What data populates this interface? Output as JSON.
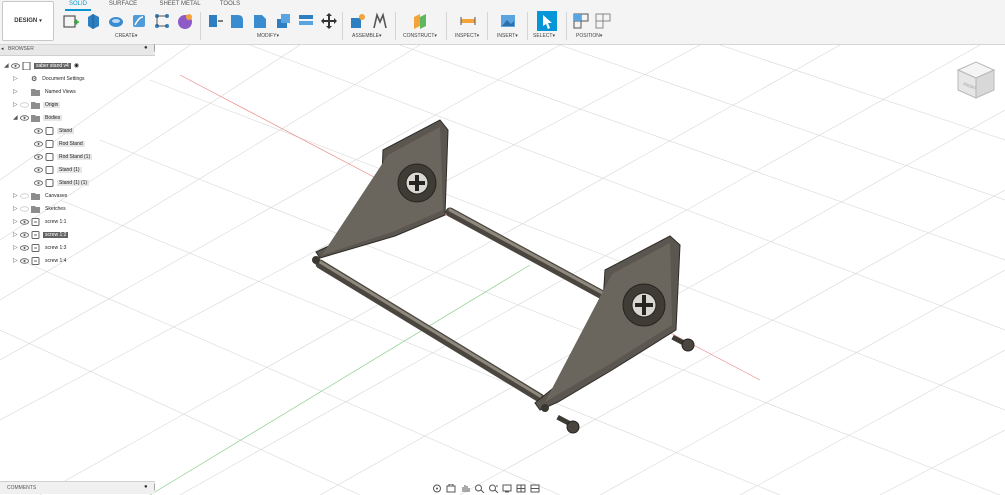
{
  "toolbar": {
    "workspace": "DESIGN",
    "tabs": [
      "SOLID",
      "SURFACE",
      "SHEET METAL",
      "TOOLS"
    ],
    "groups": [
      "CREATE",
      "MODIFY",
      "ASSEMBLE",
      "CONSTRUCT",
      "INSPECT",
      "INSERT",
      "SELECT",
      "POSITION"
    ],
    "accent": "#0696d7"
  },
  "browser": {
    "title": "BROWSER",
    "root": "saber stand v4",
    "items": [
      {
        "label": "Document Settings",
        "icon": "gear-icon"
      },
      {
        "label": "Named Views",
        "icon": "folder-icon"
      },
      {
        "label": "Origin",
        "icon": "folder-icon"
      },
      {
        "label": "Bodies",
        "icon": "folder-icon"
      },
      {
        "label": "Stand",
        "icon": "body-icon"
      },
      {
        "label": "Rod Stand",
        "icon": "body-icon"
      },
      {
        "label": "Rod Stand (1)",
        "icon": "body-icon"
      },
      {
        "label": "Stand (1)",
        "icon": "body-icon"
      },
      {
        "label": "Stand (1) (1)",
        "icon": "body-icon"
      },
      {
        "label": "Canvases",
        "icon": "folder-icon"
      },
      {
        "label": "Sketches",
        "icon": "folder-icon"
      },
      {
        "label": "screw 1:1",
        "icon": "component-icon"
      },
      {
        "label": "screw 1:2",
        "icon": "component-icon"
      },
      {
        "label": "screw 1:3",
        "icon": "component-icon"
      },
      {
        "label": "screw 1:4",
        "icon": "component-icon"
      }
    ]
  },
  "comments": {
    "title": "COMMENTS"
  },
  "viewcube": {
    "face": "FRONT"
  }
}
